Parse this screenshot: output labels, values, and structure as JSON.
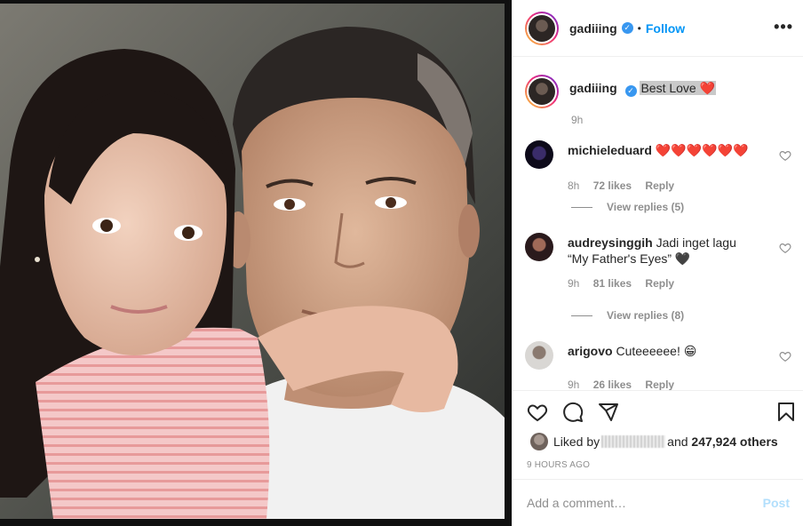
{
  "header": {
    "username": "gadiiing",
    "separator": "•",
    "follow_label": "Follow",
    "more_label": "•••"
  },
  "caption": {
    "username": "gadiiing",
    "text": "Best Love",
    "emoji": "❤️",
    "time": "9h"
  },
  "comments": [
    {
      "username": "michieleduard",
      "text": "",
      "emoji": "❤️❤️❤️❤️❤️❤️",
      "time": "8h",
      "likes": "72 likes",
      "reply": "Reply",
      "view_replies": "View replies (5)"
    },
    {
      "username": "audreysinggih",
      "text": "Jadi inget lagu “My Father's Eyes”",
      "emoji": "🖤",
      "time": "9h",
      "likes": "81 likes",
      "reply": "Reply",
      "view_replies": "View replies (8)"
    },
    {
      "username": "arigovo",
      "text": "Cuteeeeee!",
      "emoji": "😁",
      "time": "9h",
      "likes": "26 likes",
      "reply": "Reply"
    }
  ],
  "liked_by": {
    "prefix": "Liked by",
    "middle": "and",
    "count": "247,924 others"
  },
  "posted_ago": "9 HOURS AGO",
  "add_comment": {
    "placeholder": "Add a comment…",
    "post_label": "Post"
  },
  "colors": {
    "accent": "#0095f6",
    "verified": "#3897f0",
    "post_disabled": "#b2dffc",
    "muted": "#8e8e8e"
  }
}
